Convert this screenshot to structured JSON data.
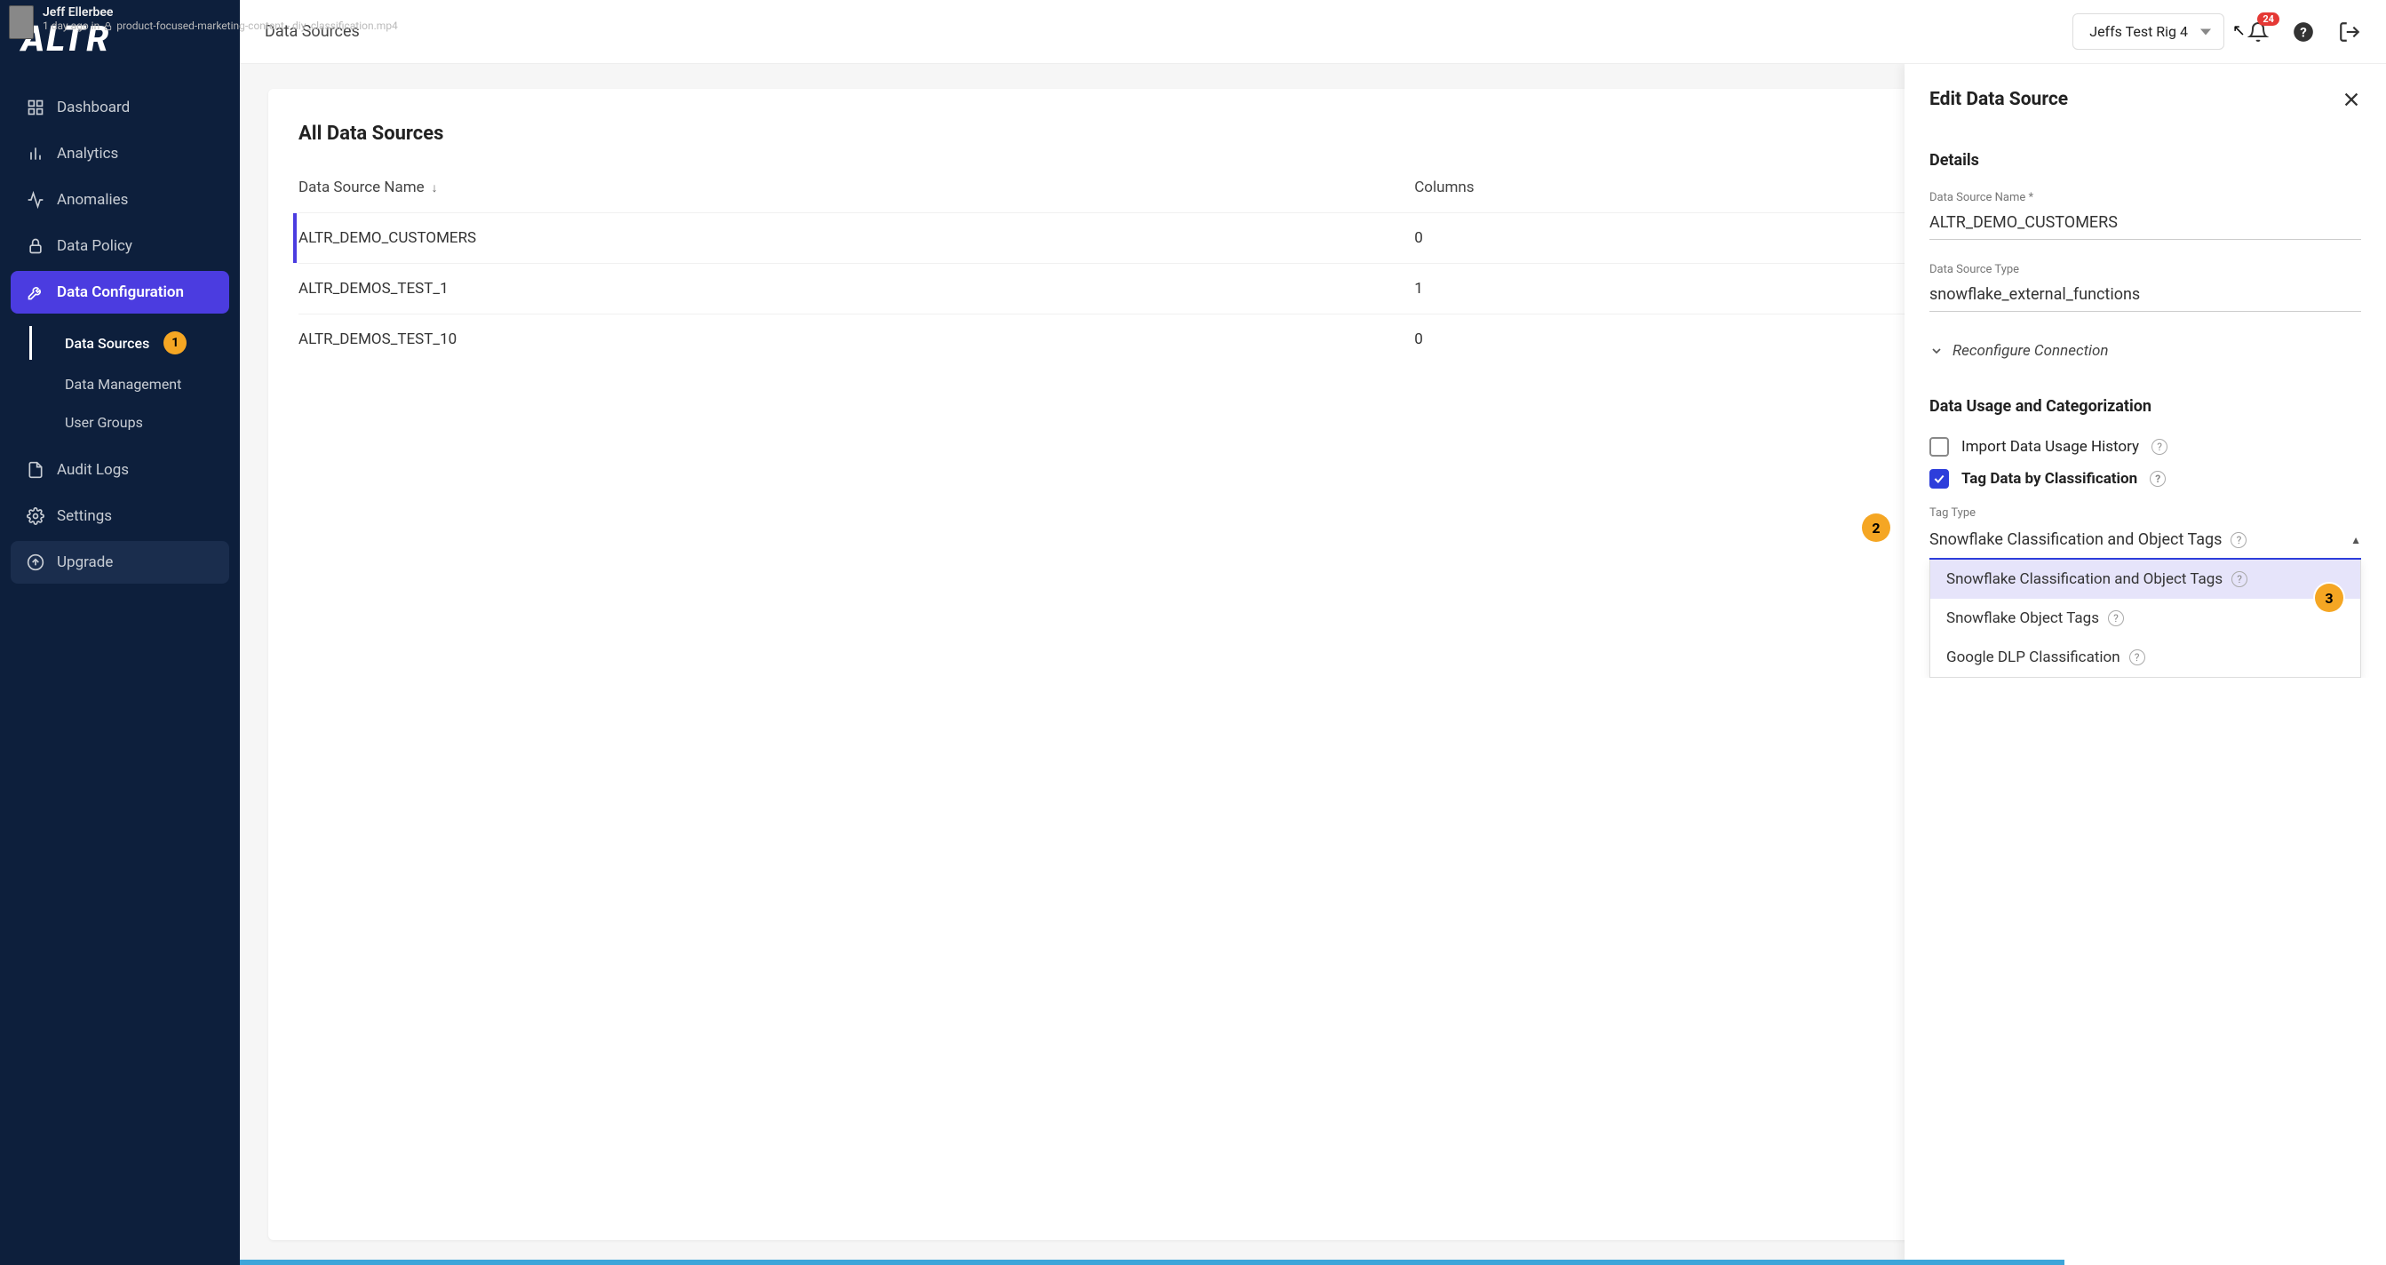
{
  "overlay": {
    "name": "Jeff Ellerbee",
    "meta_prefix": "1 day ago in",
    "meta_file": "product-focused-marketing-content - diy_classification.mp4"
  },
  "logo_text": "ALTR",
  "nav": {
    "dashboard": "Dashboard",
    "analytics": "Analytics",
    "anomalies": "Anomalies",
    "data_policy": "Data Policy",
    "data_config": "Data Configuration",
    "sub": {
      "data_sources": "Data Sources",
      "data_sources_badge": "1",
      "data_management": "Data Management",
      "user_groups": "User Groups"
    },
    "audit_logs": "Audit Logs",
    "settings": "Settings",
    "upgrade": "Upgrade"
  },
  "topbar": {
    "breadcrumb": "Data Sources",
    "rig": "Jeffs Test Rig 4",
    "notif_count": "24"
  },
  "table": {
    "title": "All Data Sources",
    "col_name": "Data Source Name",
    "col_columns": "Columns",
    "rows": [
      {
        "name": "ALTR_DEMO_CUSTOMERS",
        "columns": "0"
      },
      {
        "name": "ALTR_DEMOS_TEST_1",
        "columns": "1"
      },
      {
        "name": "ALTR_DEMOS_TEST_10",
        "columns": "0"
      }
    ]
  },
  "panel": {
    "title": "Edit Data Source",
    "details": "Details",
    "ds_name_label": "Data Source Name *",
    "ds_name_value": "ALTR_DEMO_CUSTOMERS",
    "ds_type_label": "Data Source Type",
    "ds_type_value": "snowflake_external_functions",
    "reconfig": "Reconfigure Connection",
    "usage_title": "Data Usage and Categorization",
    "import_history": "Import Data Usage History",
    "tag_by_class": "Tag Data by Classification",
    "tag_type_label": "Tag Type",
    "tag_type_value": "Snowflake Classification and Object Tags",
    "options": [
      "Snowflake Classification and Object Tags",
      "Snowflake Object Tags",
      "Google DLP Classification"
    ]
  },
  "callouts": {
    "c1": "1",
    "c2": "2",
    "c3": "3"
  }
}
